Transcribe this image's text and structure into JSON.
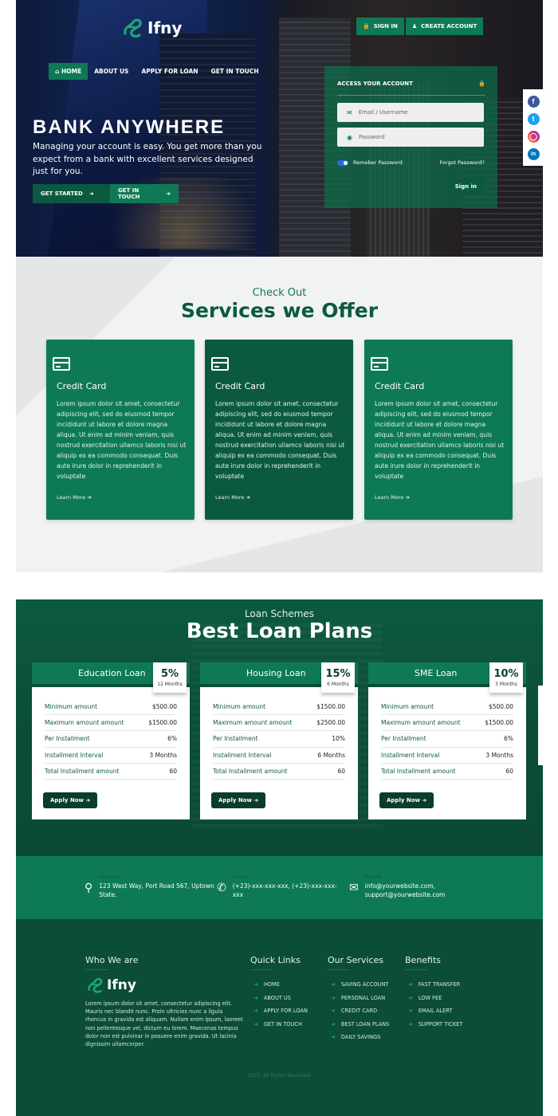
{
  "brand": {
    "name": "Ifny",
    "accent": "#0e7a55",
    "dark": "#0b4d36"
  },
  "nav": {
    "items": [
      {
        "label": "HOME",
        "icon": "home-icon",
        "active": true
      },
      {
        "label": "ABOUT US"
      },
      {
        "label": "APPLY FOR LOAN"
      },
      {
        "label": "GET IN TOUCH"
      }
    ]
  },
  "auth": {
    "sign_in": "SIGN IN",
    "create_account": "CREATE ACCOUNT"
  },
  "hero": {
    "title": "BANK ANYWHERE",
    "subtitle": "Managing your account is easy. You get more than you expect from a bank with excellent services designed just for you.",
    "btn_started": "GET STARTED",
    "btn_touch": "GET IN TOUCH"
  },
  "login": {
    "heading": "ACCESS YOUR ACCOUNT",
    "email_placeholder": "Email / Username",
    "password_placeholder": "Password",
    "remember": "Remeber Password",
    "remember_on": true,
    "forgot": "Forgot Password?",
    "submit": "Sign in"
  },
  "social": [
    "facebook",
    "twitter",
    "instagram",
    "linkedin"
  ],
  "services": {
    "kicker": "Check Out",
    "title": "Services we Offer",
    "cards": [
      {
        "title": "Credit Card",
        "text": "Lorem ipsum dolor sit amet, consectetur adipiscing elit, sed do eiusmod tempor incididunt ut labore et dolore magna aliqua. Ut enim ad minim veniam, quis nostrud exercitation ullamco laboris nisi ut aliquip ex ea commodo consequat. Duis aute irure dolor in reprehenderit in voluptate",
        "more": "Learn More"
      },
      {
        "title": "Credit Card",
        "text": "Lorem ipsum dolor sit amet, consectetur adipiscing elit, sed do eiusmod tempor incididunt ut labore et dolore magna aliqua. Ut enim ad minim veniam, quis nostrud exercitation ullamco laboris nisi ut aliquip ex ea commodo consequat. Duis aute irure dolor in reprehenderit in voluptate",
        "more": "Learn More"
      },
      {
        "title": "Credit Card",
        "text": "Lorem ipsum dolor sit amet, consectetur adipiscing elit, sed do eiusmod tempor incididunt ut labore et dolore magna aliqua. Ut enim ad minim veniam, quis nostrud exercitation ullamco laboris nisi ut aliquip ex ea commodo consequat. Duis aute irure dolor in reprehenderit in voluptate",
        "more": "Learn More"
      }
    ]
  },
  "loans": {
    "kicker": "Loan Schemes",
    "title": "Best Loan Plans",
    "apply_label": "Apply Now",
    "plans": [
      {
        "name": "Education Loan",
        "rate": "5%",
        "term": "12 Months",
        "rows": [
          {
            "label": "Minimum amount",
            "value": "$500.00"
          },
          {
            "label": "Maximum amount amount",
            "value": "$1500.00"
          },
          {
            "label": "Per Installment",
            "value": "6%"
          },
          {
            "label": "Installment Interval",
            "value": "3 Months"
          },
          {
            "label": "Total Installment amount",
            "value": "60"
          }
        ]
      },
      {
        "name": "Housing Loan",
        "rate": "15%",
        "term": "6 Months",
        "rows": [
          {
            "label": "Minimum amount",
            "value": "$1500.00"
          },
          {
            "label": "Maximum amount amount",
            "value": "$2500.00"
          },
          {
            "label": "Per Installment",
            "value": "10%"
          },
          {
            "label": "Installment Interval",
            "value": "6 Months"
          },
          {
            "label": "Total Installment amount",
            "value": "60"
          }
        ]
      },
      {
        "name": "SME Loan",
        "rate": "10%",
        "term": "3 Months",
        "rows": [
          {
            "label": "Minimum amount",
            "value": "$500.00"
          },
          {
            "label": "Maximum amount amount",
            "value": "$1500.00"
          },
          {
            "label": "Per Installment",
            "value": "6%"
          },
          {
            "label": "Installment Interval",
            "value": "3 Months"
          },
          {
            "label": "Total Installment amount",
            "value": "60"
          }
        ]
      }
    ]
  },
  "contact": {
    "location": {
      "label": "Location",
      "value": "123 West Way, Port Road 567, Uptown State."
    },
    "phone": {
      "label": "Phone",
      "value": "(+23)-xxx-xxx-xxx, (+23)-xxx-xxx-xxx"
    },
    "email": {
      "label": "Emails",
      "value": "info@yourwebsite.com, support@yourwebsite.com"
    }
  },
  "footer": {
    "who_title": "Who We are",
    "about": "Lorem ipsum dolor sit amet, consectetur adipiscing elit. Mauris nec blandit nunc. Proin ultricies nunc a ligula rhoncus in gravida est aliquam. Nullam enim ipsum, laoreet non pellentesque vel, dictum eu lorem. Maecenas tempus dolor non est pulvinar in posuere enim gravida. Ut lacinia dignissim ullamcorper.",
    "quick_title": "Quick Links",
    "quick": [
      "HOME",
      "ABOUT US",
      "APPLY FOR LOAN",
      "GET IN TOUCH"
    ],
    "services_title": "Our Services",
    "services": [
      "SAVING ACCOUNT",
      "PERSONAL LOAN",
      "CREDIT CARD",
      "BEST LOAN PLANS",
      "DAILY SAVINGS"
    ],
    "benefits_title": "Benefits",
    "benefits": [
      "FAST TRANSFER",
      "LOW FEE",
      "EMAIL ALERT",
      "SUPPORT TICKET"
    ],
    "copyright": "2023. All Rights Reserved."
  }
}
